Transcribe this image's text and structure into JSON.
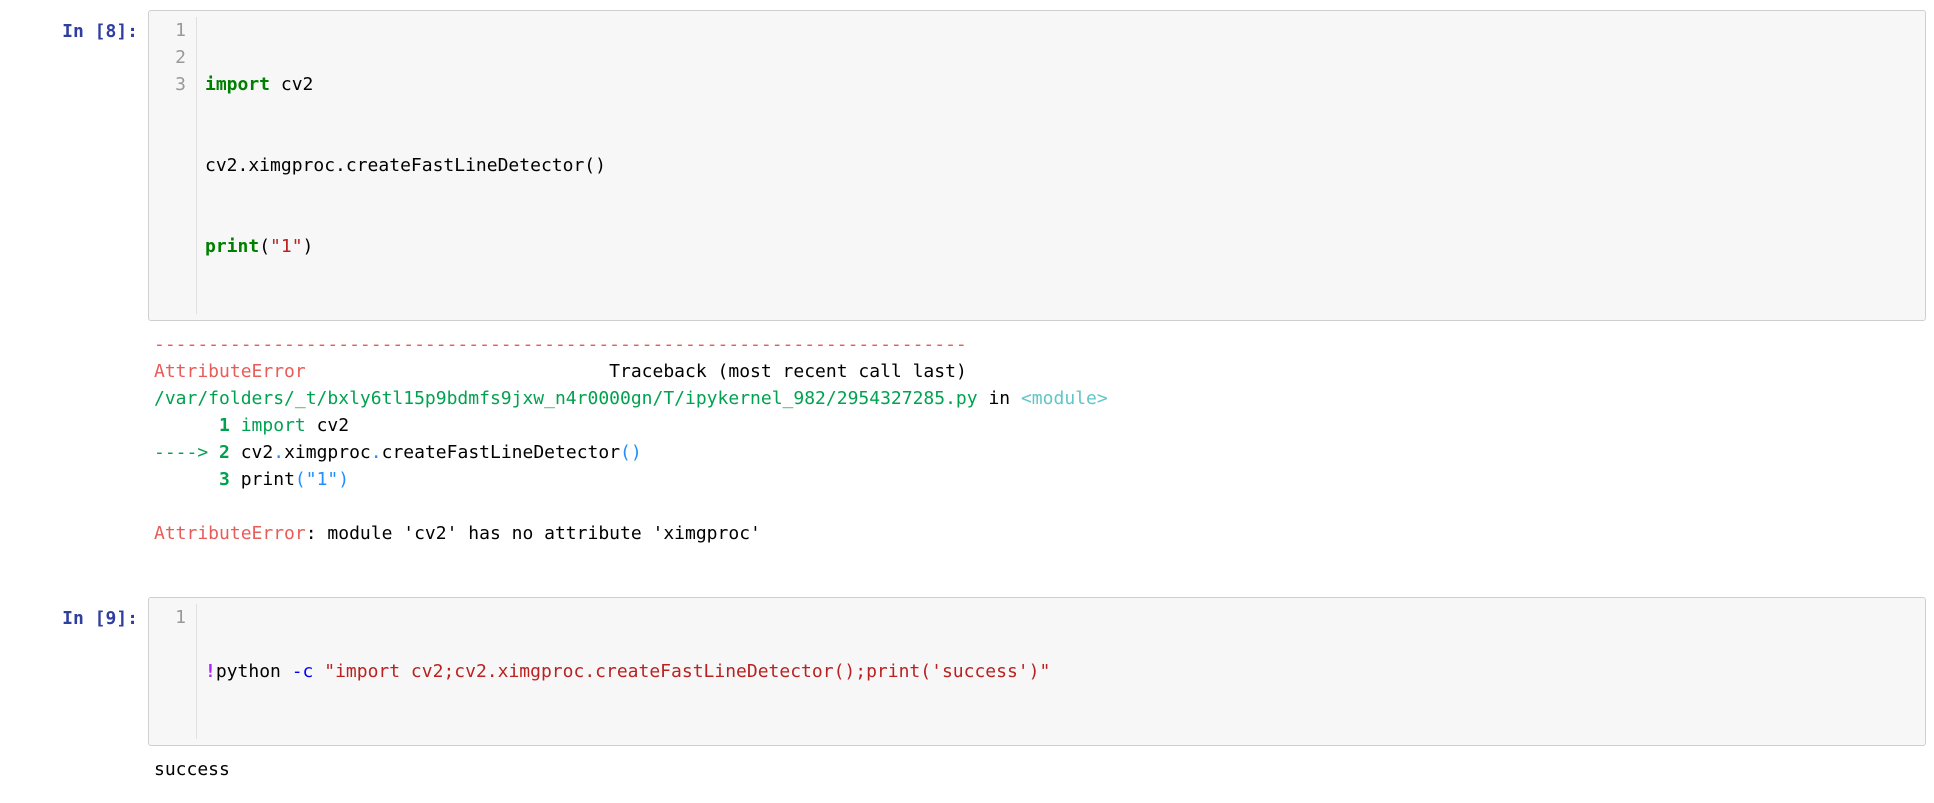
{
  "cells": [
    {
      "prompt_label": "In [",
      "prompt_num": "8",
      "prompt_close": "]:",
      "gutter": [
        "1",
        "2",
        "3"
      ],
      "code": {
        "l1_kw": "import",
        "l1_rest": " cv2",
        "l2": "cv2.ximgproc.createFastLineDetector()",
        "l3_fn": "print",
        "l3_open": "(",
        "l3_str": "\"1\"",
        "l3_close": ")"
      }
    },
    {
      "prompt_label": "In [",
      "prompt_num": "9",
      "prompt_close": "]:",
      "gutter": [
        "1"
      ],
      "code": {
        "l1_bang": "!",
        "l1_python": "python ",
        "l1_flag": "-c",
        "l1_sp": " ",
        "l1_str": "\"import cv2;cv2.ximgproc.createFastLineDetector();print('success')\""
      }
    }
  ],
  "traceback": {
    "dashes": "---------------------------------------------------------------------------",
    "err_name": "AttributeError",
    "err_pad": "                            ",
    "tb_label": "Traceback (most recent call last)",
    "path": "/var/folders/_t/bxly6tl15p9bdmfs9jxw_n4r0000gn/T/ipykernel_982/2954327285.py",
    "in": " in ",
    "module": "<module>",
    "frame": {
      "l1_pre": "      ",
      "l1_num": "1",
      "l1_sp": " ",
      "l1_kw": "import",
      "l1_rest": " cv2",
      "l2_arrow": "----> ",
      "l2_num": "2",
      "l2_sp": " ",
      "l2_a": "cv2",
      "l2_dot1": ".",
      "l2_b": "ximgproc",
      "l2_dot2": ".",
      "l2_c": "createFastLineDetector",
      "l2_op": "(",
      "l2_cp": ")",
      "l3_pre": "      ",
      "l3_num": "3",
      "l3_sp": " ",
      "l3_fn": "print",
      "l3_op": "(",
      "l3_str": "\"1\"",
      "l3_cp": ")"
    },
    "final_err": "AttributeError",
    "final_msg": ": module 'cv2' has no attribute 'ximgproc'"
  },
  "output2": "success"
}
